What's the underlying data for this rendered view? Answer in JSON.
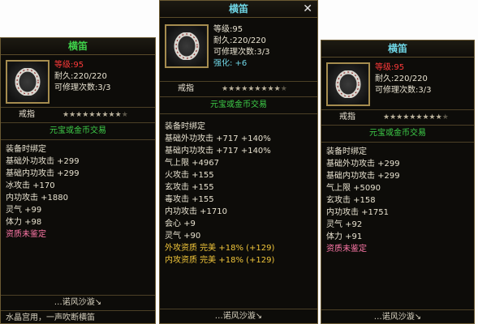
{
  "panels": [
    {
      "title": "横笛",
      "level_label": "等级:",
      "level_value": "95",
      "durability": "耐久:220/220",
      "repair": "可修理次数:3/3",
      "strengthen": "",
      "item_type": "戒指",
      "stars_on": 9,
      "stars_total": 10,
      "trade": "元宝或金币交易",
      "attrs": [
        {
          "text": "装备时绑定",
          "color": "#e8e2d0"
        },
        {
          "text": "基础外功攻击 +299",
          "color": "#e8e2d0"
        },
        {
          "text": "基础内功攻击 +299",
          "color": "#e8e2d0"
        },
        {
          "text": "冰攻击 +170",
          "color": "#e8e2d0"
        },
        {
          "text": "内功攻击 +1880",
          "color": "#e8e2d0"
        },
        {
          "text": "灵气 +99",
          "color": "#e8e2d0"
        },
        {
          "text": "体力 +98",
          "color": "#e8e2d0"
        },
        {
          "text": "资质未鉴定",
          "color": "#ff78a8"
        }
      ],
      "footer": "…诺风沙漩↘",
      "extra": "水晶宫用，一声吹断横笛"
    },
    {
      "title": "横笛",
      "close": "✕",
      "level_label": "等级:",
      "level_value": "95",
      "durability": "耐久:220/220",
      "repair": "可修理次数:3/3",
      "strengthen": "强化: +6",
      "item_type": "戒指",
      "stars_on": 9,
      "stars_total": 10,
      "trade": "元宝或金币交易",
      "attrs": [
        {
          "text": "装备时绑定",
          "color": "#e8e2d0"
        },
        {
          "text": "基础外功攻击 +717 +140%",
          "color": "#e8e2d0"
        },
        {
          "text": "基础内功攻击 +717 +140%",
          "color": "#e8e2d0"
        },
        {
          "text": "气上限 +4967",
          "color": "#e8e2d0"
        },
        {
          "text": "火攻击 +155",
          "color": "#e8e2d0"
        },
        {
          "text": "玄攻击 +155",
          "color": "#e8e2d0"
        },
        {
          "text": "毒攻击 +155",
          "color": "#e8e2d0"
        },
        {
          "text": "内功攻击 +1710",
          "color": "#e8e2d0"
        },
        {
          "text": "会心 +9",
          "color": "#e8e2d0"
        },
        {
          "text": "灵气 +90",
          "color": "#e8e2d0"
        },
        {
          "text": "外攻资质  完美 +18% (+129)",
          "color": "#f0c53a"
        },
        {
          "text": "内攻资质  完美 +18% (+129)",
          "color": "#f0c53a"
        }
      ],
      "footer": "…诺风沙漩↘"
    },
    {
      "title": "横笛",
      "level_label": "等级:",
      "level_value": "95",
      "durability": "耐久:220/220",
      "repair": "可修理次数:3/3",
      "strengthen": "",
      "item_type": "戒指",
      "stars_on": 9,
      "stars_total": 10,
      "trade": "元宝或金币交易",
      "attrs": [
        {
          "text": "装备时绑定",
          "color": "#e8e2d0"
        },
        {
          "text": "基础外功攻击 +299",
          "color": "#e8e2d0"
        },
        {
          "text": "基础内功攻击 +299",
          "color": "#e8e2d0"
        },
        {
          "text": "气上限 +5090",
          "color": "#e8e2d0"
        },
        {
          "text": "玄攻击 +158",
          "color": "#e8e2d0"
        },
        {
          "text": "内功攻击 +1751",
          "color": "#e8e2d0"
        },
        {
          "text": "灵气 +92",
          "color": "#e8e2d0"
        },
        {
          "text": "体力 +91",
          "color": "#e8e2d0"
        },
        {
          "text": "资质未鉴定",
          "color": "#ff78a8"
        }
      ],
      "footer": "…诺风沙漩↘"
    }
  ]
}
